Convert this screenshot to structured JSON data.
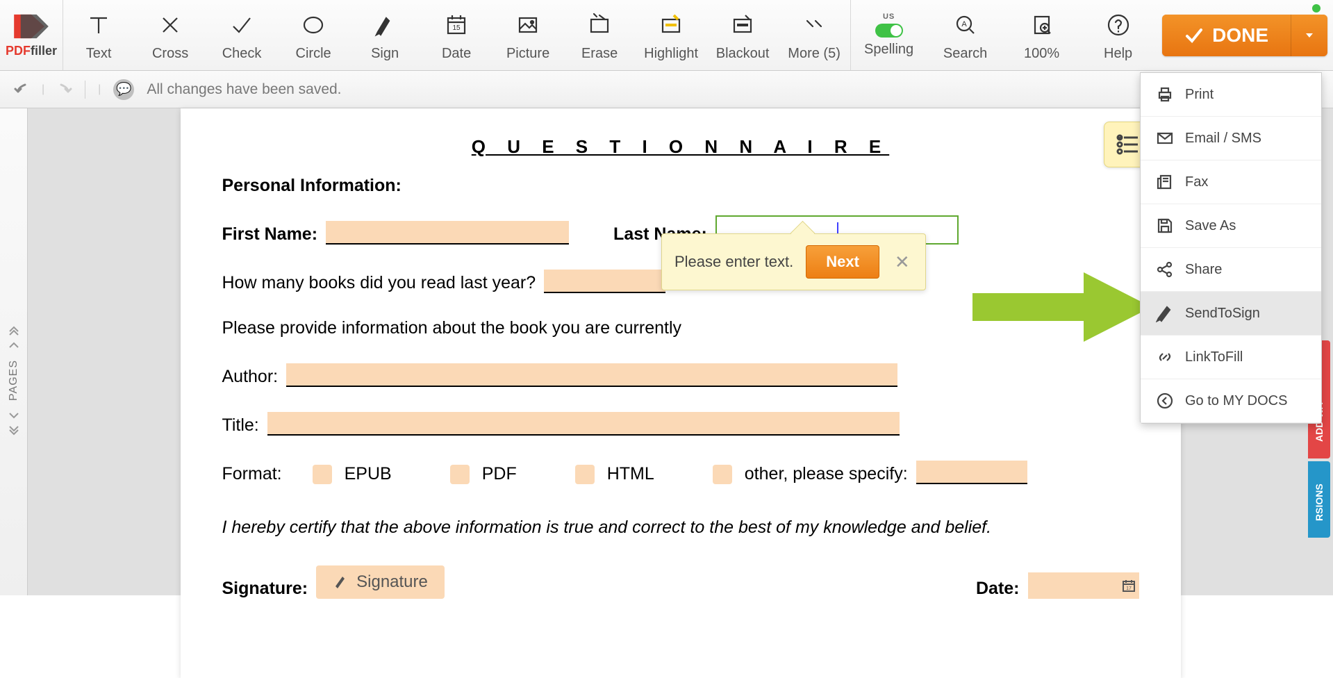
{
  "logo": {
    "pdf": "PDF",
    "filler": "filler"
  },
  "toolbar": {
    "text": "Text",
    "cross": "Cross",
    "check": "Check",
    "circle": "Circle",
    "sign": "Sign",
    "date": "Date",
    "picture": "Picture",
    "erase": "Erase",
    "highlight": "Highlight",
    "blackout": "Blackout",
    "more": "More (5)",
    "spelling_us": "US",
    "spelling": "Spelling",
    "search": "Search",
    "zoom": "100%",
    "help": "Help"
  },
  "done": {
    "label": "DONE"
  },
  "status": {
    "text": "All changes have been saved."
  },
  "rail": {
    "pages": "PAGES"
  },
  "document": {
    "title": "Q U E S T I O N N A I R E",
    "section_personal": "Personal Information",
    "first_name": "First Name",
    "last_name": "Last Name",
    "books_q": "How many books did you read last year?",
    "current_book": "Please provide information about the book you are currently",
    "author": "Author:",
    "title_lbl": "Title:",
    "format": "Format:",
    "fmt_epub": "EPUB",
    "fmt_pdf": "PDF",
    "fmt_html": "HTML",
    "fmt_other": "other, please specify:",
    "certify": "I hereby certify that the above information is true and correct to the best of my knowledge and belief.",
    "signature_lbl": "Signature",
    "signature_btn": "Signature",
    "date_lbl": "Date"
  },
  "tooltip": {
    "text": "Please enter text.",
    "next": "Next"
  },
  "menu": {
    "print": "Print",
    "email": "Email / SMS",
    "fax": "Fax",
    "saveas": "Save As",
    "share": "Share",
    "sendtosign": "SendToSign",
    "linktofill": "LinkToFill",
    "mydocs": "Go to MY DOCS"
  },
  "right_tabs": {
    "addwa": "ADD WA",
    "rsions": "RSIONS"
  }
}
